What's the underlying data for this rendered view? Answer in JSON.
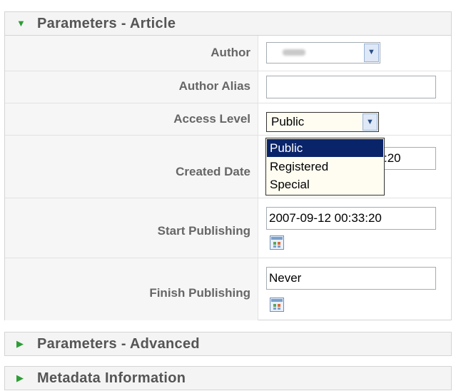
{
  "article_panel": {
    "title": "Parameters - Article",
    "fields": {
      "author": {
        "label": "Author",
        "value": ""
      },
      "author_alias": {
        "label": "Author Alias",
        "value": ""
      },
      "access_level": {
        "label": "Access Level",
        "selected": "Public",
        "options": [
          "Public",
          "Registered",
          "Special"
        ],
        "highlighted": "Public"
      },
      "created_date": {
        "label": "Created Date",
        "value": ":20"
      },
      "start_publishing": {
        "label": "Start Publishing",
        "value": "2007-09-12 00:33:20"
      },
      "finish_publishing": {
        "label": "Finish Publishing",
        "value": "Never"
      }
    }
  },
  "advanced_panel": {
    "title": "Parameters - Advanced"
  },
  "metadata_panel": {
    "title": "Metadata Information"
  },
  "icons": {
    "expanded": "triangle-down-icon",
    "collapsed": "triangle-right-icon",
    "select": "chevron-down-icon",
    "calendar": "calendar-icon"
  },
  "colors": {
    "arrow": "#2c9d34",
    "selected_option": "#0a246a",
    "dropdown_bg": "#fffdf2"
  }
}
